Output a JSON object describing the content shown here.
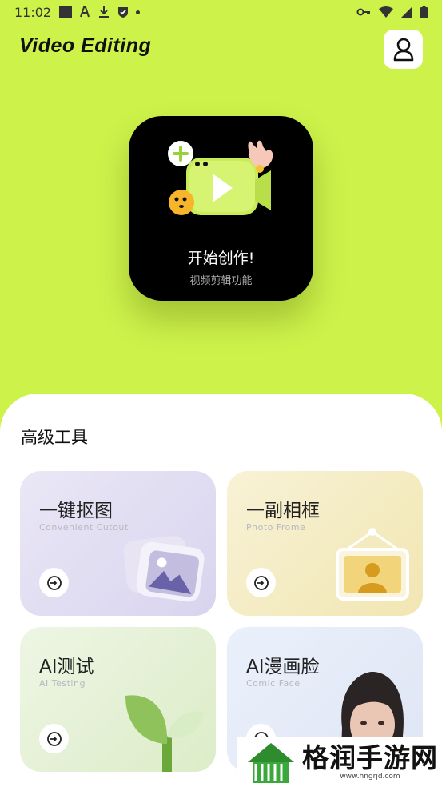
{
  "status_bar": {
    "time": "11:02"
  },
  "header": {
    "title": "Video Editing"
  },
  "hero": {
    "title": "开始创作!",
    "subtitle": "视频剪辑功能"
  },
  "tools": {
    "section_title": "高级工具",
    "cards": [
      {
        "title": "一键抠图",
        "subtitle": "Convenient Cutout"
      },
      {
        "title": "一副相框",
        "subtitle": "Photo Frome"
      },
      {
        "title": "AI测试",
        "subtitle": "AI Testing"
      },
      {
        "title": "AI漫画脸",
        "subtitle": "Comic Face"
      }
    ]
  },
  "watermark": {
    "text": "格润手游网",
    "url": "www.hngrjd.com"
  },
  "colors": {
    "background": "#cdf24a",
    "hero_bg": "#000000",
    "accent_green": "#b8e04a"
  }
}
